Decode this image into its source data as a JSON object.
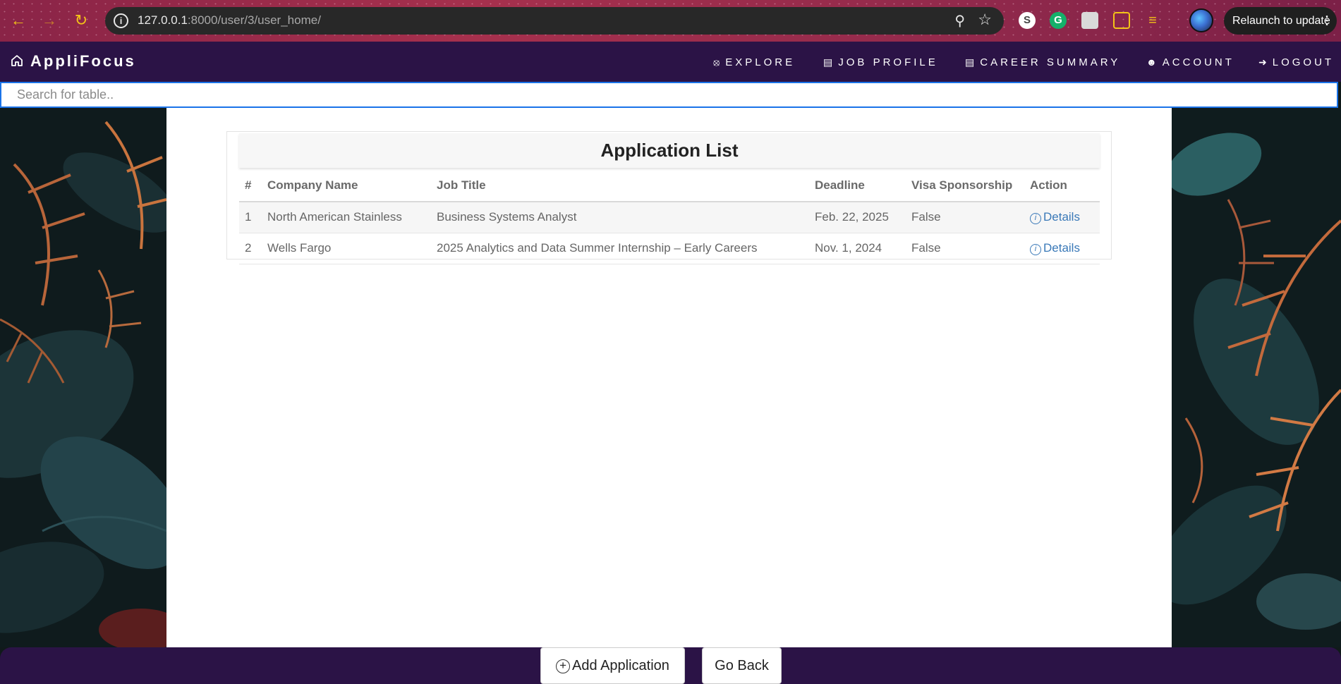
{
  "browser": {
    "url_host": "127.0.0.1",
    "url_rest": ":8000/user/3/user_home/",
    "relaunch_label": "Relaunch to update"
  },
  "nav": {
    "brand": "AppliFocus",
    "items": [
      {
        "label": "EXPLORE",
        "icon": "compass-icon"
      },
      {
        "label": "JOB PROFILE",
        "icon": "briefcase-icon"
      },
      {
        "label": "CAREER SUMMARY",
        "icon": "briefcase-icon"
      },
      {
        "label": "ACCOUNT",
        "icon": "user-icon"
      },
      {
        "label": "LOGOUT",
        "icon": "logout-icon"
      }
    ]
  },
  "search": {
    "placeholder": "Search for table.."
  },
  "table": {
    "title": "Application List",
    "headers": [
      "#",
      "Company Name",
      "Job Title",
      "Deadline",
      "Visa Sponsorship",
      "Action"
    ],
    "rows": [
      {
        "num": "1",
        "company": "North American Stainless",
        "job": "Business Systems Analyst",
        "deadline": "Feb. 22, 2025",
        "visa": "False",
        "action": "Details"
      },
      {
        "num": "2",
        "company": "Wells Fargo",
        "job": "2025 Analytics and Data Summer Internship – Early Careers",
        "deadline": "Nov. 1, 2024",
        "visa": "False",
        "action": "Details"
      }
    ]
  },
  "footer": {
    "add_label": "Add Application",
    "back_label": "Go Back"
  },
  "colors": {
    "nav_bg": "#2b1346",
    "link": "#3a79b8",
    "browser_accent": "#f3c317"
  }
}
